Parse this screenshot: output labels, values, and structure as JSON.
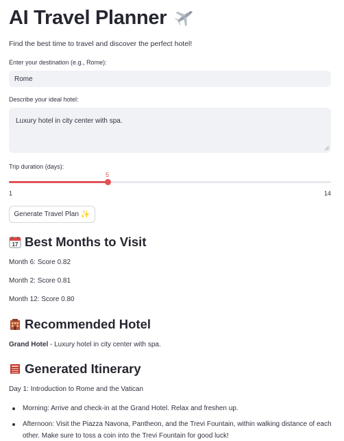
{
  "header": {
    "title": "AI Travel Planner",
    "title_icon": "airplane-icon",
    "subtitle": "Find the best time to travel and discover the perfect hotel!"
  },
  "form": {
    "destination_label": "Enter your destination (e.g., Rome):",
    "destination_value": "Rome",
    "hotel_label": "Describe your ideal hotel:",
    "hotel_value": "Luxury hotel in city center with spa.",
    "duration_label": "Trip duration (days):",
    "duration_value": "5",
    "duration_min": "1",
    "duration_max": "14",
    "generate_button": "Generate Travel Plan"
  },
  "best_months": {
    "heading": "Best Months to Visit",
    "icon": "calendar-icon",
    "items": [
      "Month 6: Score 0.82",
      "Month 2: Score 0.81",
      "Month 12: Score 0.80"
    ]
  },
  "hotel": {
    "heading": "Recommended Hotel",
    "icon": "hotel-building-icon",
    "name": "Grand Hotel",
    "description": " - Luxury hotel in city center with spa."
  },
  "itinerary": {
    "heading": "Generated Itinerary",
    "icon": "book-icon",
    "day_title": "Day 1: Introduction to Rome and the Vatican",
    "items": [
      "Morning: Arrive and check-in at the Grand Hotel. Relax and freshen up.",
      "Afternoon: Visit the Piazza Navona, Pantheon, and the Trevi Fountain, within walking distance of each other. Make sure to toss a coin into the Trevi Fountain for good luck!"
    ]
  },
  "colors": {
    "accent": "#e05255",
    "input_bg": "#f0f2f6",
    "text": "#31333f"
  }
}
